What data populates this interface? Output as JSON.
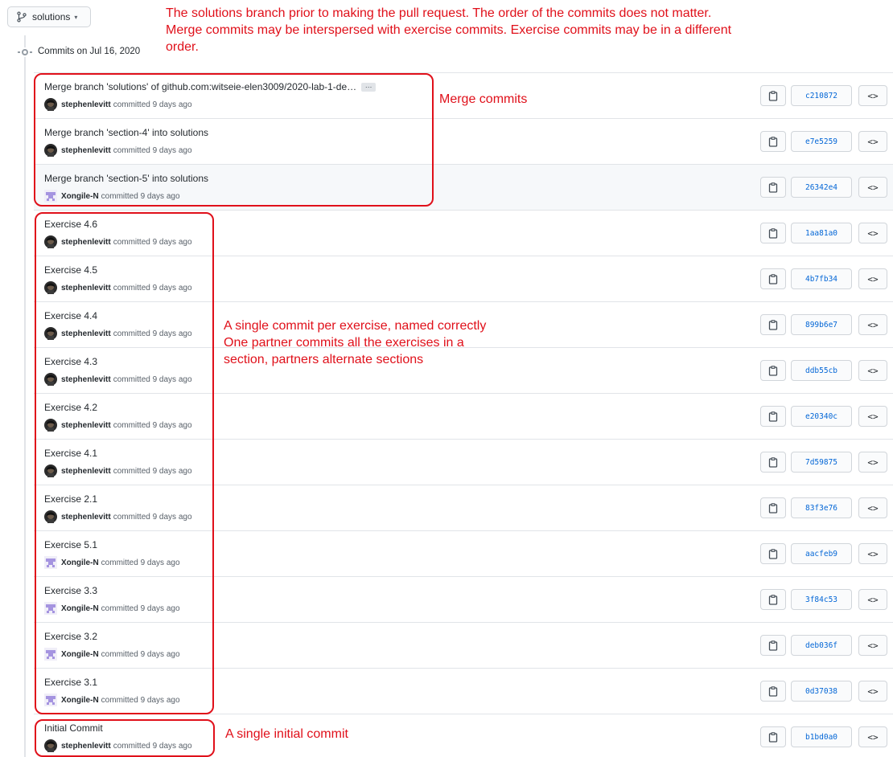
{
  "branch": {
    "label": "solutions",
    "caret": "▾"
  },
  "timeline": {
    "date_label": "Commits on Jul 16, 2020"
  },
  "committed_text": "committed 9 days ago",
  "ellipsis": "…",
  "browse_label": "<>",
  "colors": {
    "annotation": "#e0101a",
    "sha_link": "#0366d6",
    "border": "#e1e4e8"
  },
  "commits": [
    {
      "title": "Merge branch 'solutions' of github.com:witseie-elen3009/2020-lab-1-de…",
      "author": "stephenlevitt",
      "sha": "c210872",
      "avatar": "stephen",
      "truncated": true
    },
    {
      "title": "Merge branch 'section-4' into solutions",
      "author": "stephenlevitt",
      "sha": "e7e5259",
      "avatar": "stephen"
    },
    {
      "title": "Merge branch 'section-5' into solutions",
      "author": "Xongile-N",
      "sha": "26342e4",
      "avatar": "xongile",
      "highlight": true
    },
    {
      "title": "Exercise 4.6",
      "author": "stephenlevitt",
      "sha": "1aa81a0",
      "avatar": "stephen"
    },
    {
      "title": "Exercise 4.5",
      "author": "stephenlevitt",
      "sha": "4b7fb34",
      "avatar": "stephen"
    },
    {
      "title": "Exercise 4.4",
      "author": "stephenlevitt",
      "sha": "899b6e7",
      "avatar": "stephen"
    },
    {
      "title": "Exercise 4.3",
      "author": "stephenlevitt",
      "sha": "ddb55cb",
      "avatar": "stephen"
    },
    {
      "title": "Exercise 4.2",
      "author": "stephenlevitt",
      "sha": "e20340c",
      "avatar": "stephen"
    },
    {
      "title": "Exercise 4.1",
      "author": "stephenlevitt",
      "sha": "7d59875",
      "avatar": "stephen"
    },
    {
      "title": "Exercise 2.1",
      "author": "stephenlevitt",
      "sha": "83f3e76",
      "avatar": "stephen"
    },
    {
      "title": "Exercise 5.1",
      "author": "Xongile-N",
      "sha": "aacfeb9",
      "avatar": "xongile"
    },
    {
      "title": "Exercise 3.3",
      "author": "Xongile-N",
      "sha": "3f84c53",
      "avatar": "xongile"
    },
    {
      "title": "Exercise 3.2",
      "author": "Xongile-N",
      "sha": "deb036f",
      "avatar": "xongile"
    },
    {
      "title": "Exercise 3.1",
      "author": "Xongile-N",
      "sha": "0d37038",
      "avatar": "xongile"
    },
    {
      "title": "Initial Commit",
      "author": "stephenlevitt",
      "sha": "b1bd0a0",
      "avatar": "stephen"
    }
  ],
  "annotations": {
    "header": [
      "The solutions branch prior to making the pull request. The order of the commits does not matter.",
      "Merge commits may be interspersed with exercise commits. Exercise commits may be in a different",
      "order."
    ],
    "merge": "Merge commits",
    "exercises": [
      "A single commit per exercise, named correctly",
      "One partner commits all the exercises in a",
      "section, partners alternate sections"
    ],
    "initial": "A single initial commit"
  }
}
